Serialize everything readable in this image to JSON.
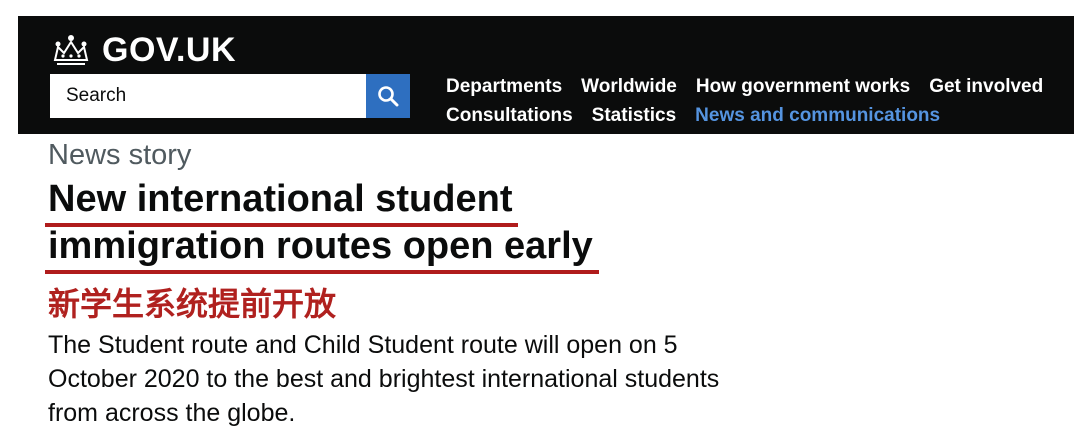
{
  "header": {
    "logo_text": "GOV.UK",
    "search": {
      "placeholder": "Search"
    },
    "nav": {
      "row1": [
        "Departments",
        "Worldwide",
        "How government works",
        "Get involved"
      ],
      "row2": [
        "Consultations",
        "Statistics",
        "News and communications"
      ],
      "current": "News and communications"
    }
  },
  "article": {
    "kicker": "News story",
    "title_line1": "New international student",
    "title_line2": "immigration routes open early",
    "subtitle_cn": "新学生系统提前开放",
    "summary": "The Student route and Child Student route will open on 5 October 2020 to the best and brightest international students from across the globe."
  },
  "icons": {
    "logo": "crown-icon",
    "search": "search-icon"
  },
  "colors": {
    "header_bg": "#0b0c0c",
    "search_button": "#2e6fc0",
    "current_nav": "#5594e0",
    "highlight_red": "#b01c1c"
  }
}
